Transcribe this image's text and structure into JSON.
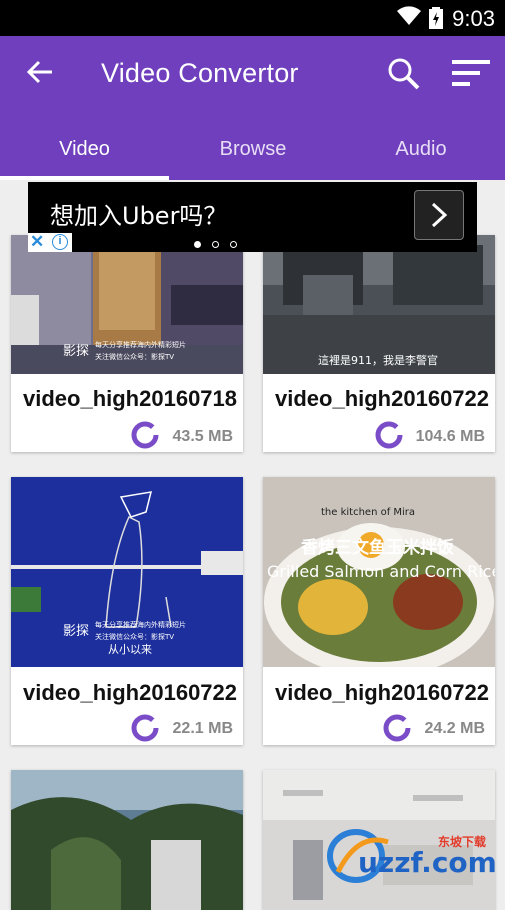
{
  "status_bar": {
    "time": "9:03"
  },
  "app_bar": {
    "title": "Video Convertor"
  },
  "tabs": [
    {
      "label": "Video",
      "active": true
    },
    {
      "label": "Browse",
      "active": false
    },
    {
      "label": "Audio",
      "active": false
    }
  ],
  "ad": {
    "text": "想加入Uber吗？",
    "page_count": 3,
    "active_page": 1
  },
  "videos": [
    {
      "name": "video_high20160718",
      "size": "43.5 MB"
    },
    {
      "name": "video_high20160722",
      "size": "104.6 MB"
    },
    {
      "name": "video_high20160722",
      "size": "22.1 MB"
    },
    {
      "name": "video_high20160722",
      "size": "24.2 MB"
    }
  ],
  "thumb_captions": {
    "v1": "影探",
    "v1_sub": "每天分享推荐海内外精彩短片\n关注微信公众号：影探TV",
    "v2": "這裡是911，我是李警官",
    "v3": "影探",
    "v3_sub": "每天分享推荐海内外精彩短片\n关注微信公众号：影探TV",
    "v3_bottom": "从小以来",
    "v4_title": "香烤三文鱼玉米拌饭",
    "v4_en": "Grilled Salmon and Corn Rice Bowl",
    "v4_small": "the kitchen of Mira"
  },
  "watermark": {
    "text": "uzzf.com",
    "sub": "东坡下载"
  },
  "colors": {
    "primary": "#6f3fbd",
    "ring": "#7a4cc8"
  }
}
